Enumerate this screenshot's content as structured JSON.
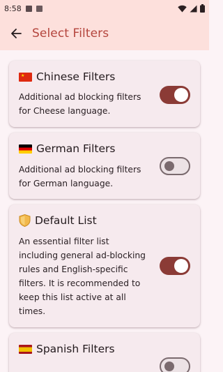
{
  "status_bar": {
    "time": "8:58"
  },
  "app_bar": {
    "title": "Select Filters",
    "back_icon": "arrow-back-icon"
  },
  "filters": [
    {
      "title": "Chinese Filters",
      "description": "Additional ad blocking filters\nfor Cheese language.",
      "enabled": true,
      "icon": "china-flag-icon"
    },
    {
      "title": "German Filters",
      "description": "Additional ad blocking filters\nfor German language.",
      "enabled": false,
      "icon": "germany-flag-icon"
    },
    {
      "title": "Default List",
      "description": "An essential filter list\nincluding general ad-blocking\nrules and English-specific\nfilters. It is recommended to\nkeep this list active at all\ntimes.",
      "enabled": true,
      "icon": "shield-icon"
    },
    {
      "title": "Spanish Filters",
      "description": "",
      "enabled": false,
      "icon": "spain-flag-icon"
    }
  ],
  "colors": {
    "accent": "#b4453d",
    "toggle_on": "#8b3b36",
    "app_bar_bg": "#fde0dc",
    "card_bg": "#f6eaee"
  }
}
